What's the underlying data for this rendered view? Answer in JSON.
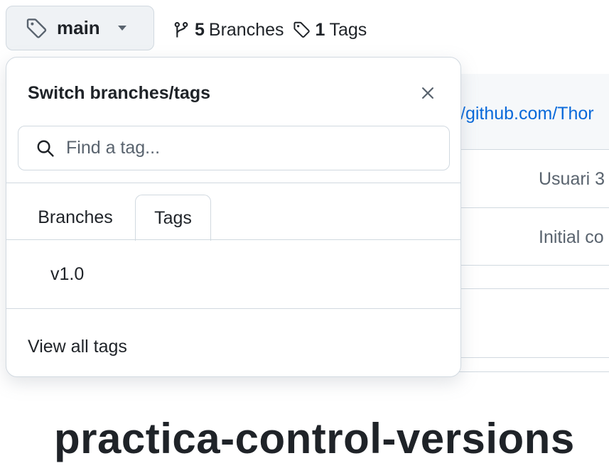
{
  "branch_button": {
    "label": "main",
    "icon": "tag-icon"
  },
  "meta": {
    "branches": {
      "count": "5",
      "label": "Branches",
      "icon": "git-branch-icon"
    },
    "tags": {
      "count": "1",
      "label": "Tags",
      "icon": "tag-icon"
    }
  },
  "background": {
    "clone_url_fragment": "/github.com/Thor",
    "commit_author_fragment": "Usuari 3",
    "commit_message_fragment": "Initial co",
    "repo_title": "practica-control-versions"
  },
  "dropdown": {
    "title": "Switch branches/tags",
    "close_icon": "x-icon",
    "search_placeholder": "Find a tag...",
    "tabs": [
      {
        "label": "Branches",
        "selected": false
      },
      {
        "label": "Tags",
        "selected": true
      }
    ],
    "items": [
      {
        "label": "v1.0"
      }
    ],
    "footer_link": "View all tags"
  },
  "colors": {
    "accent_link": "#0969da",
    "border": "#d1d9e0",
    "button_bg": "#eff2f5",
    "text": "#1f2328",
    "muted": "#59636e"
  }
}
